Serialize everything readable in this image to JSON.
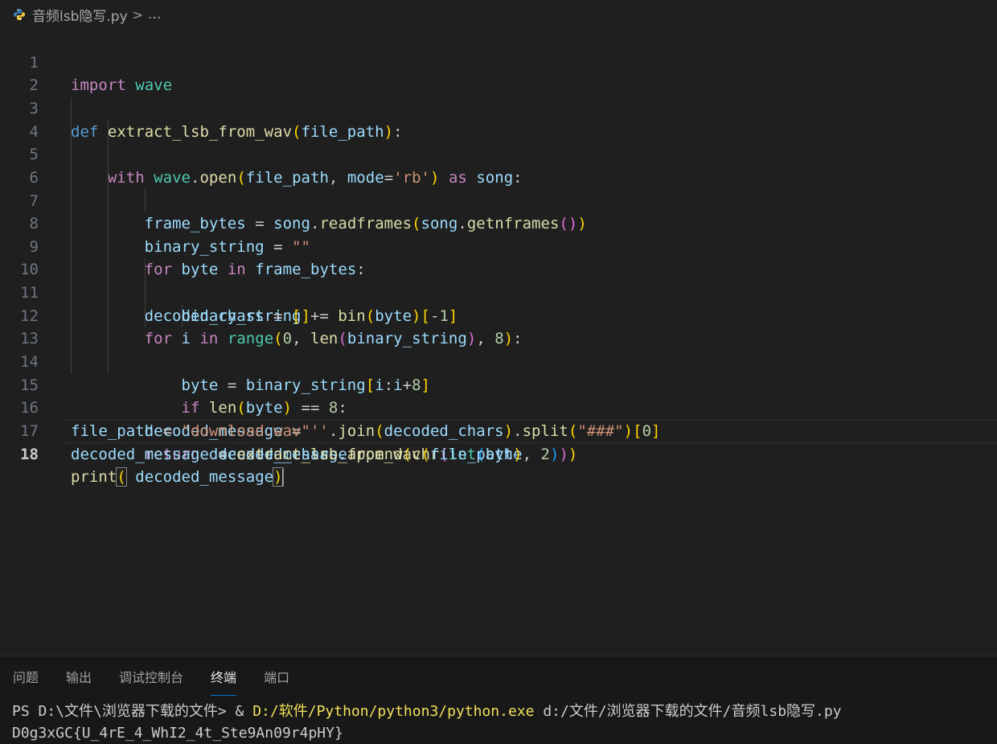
{
  "breadcrumb": {
    "file": "音频lsb隐写.py",
    "separator": ">",
    "more": "..."
  },
  "editor": {
    "line_numbers": [
      "1",
      "2",
      "3",
      "4",
      "5",
      "6",
      "7",
      "8",
      "9",
      "10",
      "11",
      "12",
      "13",
      "14",
      "15",
      "16",
      "17",
      "18"
    ],
    "current_line": "18"
  },
  "panel": {
    "tabs": [
      "问题",
      "输出",
      "调试控制台",
      "终端",
      "端口"
    ],
    "active_tab": "终端"
  },
  "terminal": {
    "prompt": "PS D:\\文件\\浏览器下载的文件> ",
    "amp": "& ",
    "exe": "D:/软件/Python/python3/python.exe",
    "arg": " d:/文件/浏览器下载的文件/音频lsb隐写.py",
    "output": "D0g3xGC{U_4rE_4_WhI2_4t_Ste9An09r4pHY}"
  },
  "colors": {
    "background": "#1f1f1f",
    "keyword": "#c586c0",
    "def": "#569cd6",
    "function": "#dcdcaa",
    "variable": "#9cdcfe",
    "class": "#4ec9b0",
    "string": "#ce9178",
    "number": "#b5cea8",
    "accent": "#0078d4"
  }
}
